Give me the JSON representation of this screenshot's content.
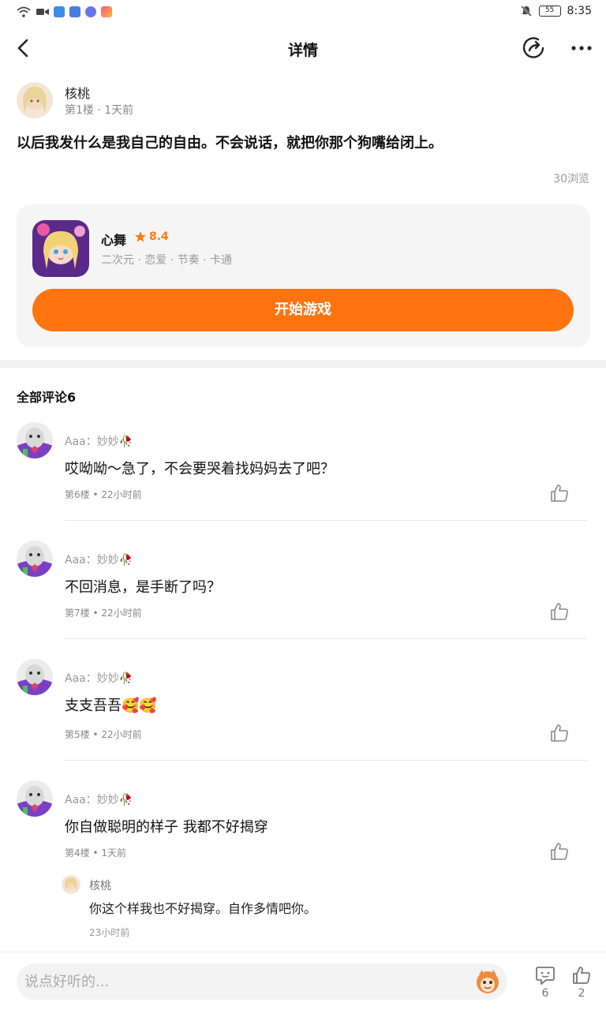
{
  "status_bar": {
    "time": "8:35",
    "battery": "55",
    "left_icons": [
      "wifi-icon",
      "video-icon",
      "cloud-icon",
      "mail-icon",
      "music-icon",
      "app-icon"
    ],
    "right_icons": [
      "mute-icon",
      "battery-icon"
    ]
  },
  "header": {
    "title": "详情",
    "icons": [
      "back-icon",
      "share-icon",
      "more-icon"
    ]
  },
  "post": {
    "author": "核桃",
    "meta": "第1楼 · 1天前",
    "text": "以后我发什么是我自己的自由。不会说话，就把你那个狗嘴给闭上。",
    "views": "30浏览"
  },
  "game": {
    "name": "心舞",
    "rating": "8.4",
    "tags": "二次元 · 恋爱 · 节奏 · 卡通",
    "play_label": "开始游戏",
    "accent": "#ff7410"
  },
  "comments_section": {
    "title": "全部评论6",
    "comments": [
      {
        "name": "Aaa：妙妙🥀",
        "text": "哎呦呦～急了，不会要哭着找妈妈去了吧？",
        "meta": "第6楼 • 22小时前"
      },
      {
        "name": "Aaa：妙妙🥀",
        "text": "不回消息，是手断了吗？",
        "meta": "第7楼 • 22小时前"
      },
      {
        "name": "Aaa：妙妙🥀",
        "text": "支支吾吾🥰🥰",
        "meta": "第5楼 • 22小时前"
      },
      {
        "name": "Aaa：妙妙🥀",
        "text": "你自做聪明的样子 我都不好揭穿",
        "meta": "第4楼 • 1天前"
      }
    ],
    "reply": {
      "name": "核桃",
      "text": "你这个样我也不好揭穿。自作多情吧你。",
      "meta": "23小时前"
    }
  },
  "bottom_bar": {
    "placeholder": "说点好听的...",
    "comment_count": "6",
    "like_count": "2"
  }
}
